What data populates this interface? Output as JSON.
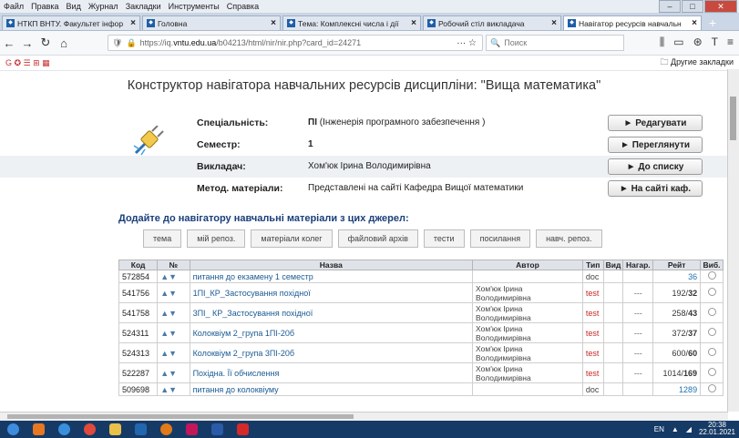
{
  "menu": [
    "Файл",
    "Правка",
    "Вид",
    "Журнал",
    "Закладки",
    "Инструменты",
    "Справка"
  ],
  "browser_tabs": [
    {
      "label": "НТКП ВНТУ. Факультет інфор",
      "active": false
    },
    {
      "label": "Головна",
      "active": false
    },
    {
      "label": "Тема: Комплексні числа і дії",
      "active": false
    },
    {
      "label": "Робочий стіл викладача",
      "active": false
    },
    {
      "label": "Навігатор ресурсів навчальн",
      "active": true
    }
  ],
  "url": {
    "prefix": "https://iq.",
    "domain": "vntu.edu.ua",
    "path": "/b04213/html/nir/nir.php?card_id=24271"
  },
  "search": {
    "placeholder": "Поиск"
  },
  "bookmarks": {
    "other": "Другие закладки"
  },
  "page": {
    "title": "Конструктор навігатора навчальних ресурсів дисципліни: \"Вища математика\"",
    "info": [
      {
        "label": "Спеціальність:",
        "value_bold": "ПІ",
        "value": " (Інженерія програмного забезпечення )"
      },
      {
        "label": "Семестр:",
        "value_bold": "1",
        "value": ""
      },
      {
        "label": "Викладач:",
        "value_bold": "",
        "value": "Хом'юк Ірина Володимирівна"
      },
      {
        "label": "Метод. матеріали:",
        "value_bold": "",
        "value": "Представлені на сайті Кафедра Вищої математики"
      }
    ],
    "buttons": [
      "► Редагувати",
      "► Переглянути",
      "► До списку",
      "► На сайті каф."
    ],
    "add_sources": "Додайте до навігатору навчальні матеріали з цих джерел:",
    "sources": [
      "тема",
      "мій репоз.",
      "матеріали колег",
      "файловий архів",
      "тести",
      "посилання",
      "навч. репоз."
    ]
  },
  "table": {
    "headers": [
      "Код",
      "№",
      "Назва",
      "Автор",
      "Тип",
      "Вид",
      "Нагар.",
      "Рейт",
      "Виб."
    ],
    "rows": [
      {
        "code": "572854",
        "arrows": "▲▼",
        "name": "питання до екзамену 1 семестр",
        "author": "",
        "type": "doc",
        "test": false,
        "award": "",
        "rating": "36",
        "rating_bold": "",
        "link": true
      },
      {
        "code": "541756",
        "arrows": "▲▼",
        "name": "1ПІ_КР_Застосування похідної",
        "author": "Хом'юк Ірина Володимирівна",
        "type": "test",
        "test": true,
        "award": "---",
        "rating": "192/",
        "rating_bold": "32",
        "link": false
      },
      {
        "code": "541758",
        "arrows": "▲▼",
        "name": "3ПІ_ КР_Застосування похідної",
        "author": "Хом'юк Ірина Володимирівна",
        "type": "test",
        "test": true,
        "award": "---",
        "rating": "258/",
        "rating_bold": "43",
        "link": false
      },
      {
        "code": "524311",
        "arrows": "▲▼",
        "name": "Колоквіум 2_група 1ПІ-20б",
        "author": "Хом'юк Ірина Володимирівна",
        "type": "test",
        "test": true,
        "award": "---",
        "rating": "372/",
        "rating_bold": "37",
        "link": false
      },
      {
        "code": "524313",
        "arrows": "▲▼",
        "name": "Колоквіум 2_група 3ПІ-20б",
        "author": "Хом'юк Ірина Володимирівна",
        "type": "test",
        "test": true,
        "award": "---",
        "rating": "600/",
        "rating_bold": "60",
        "link": false
      },
      {
        "code": "522287",
        "arrows": "▲▼",
        "name": "Похідна. Її обчислення",
        "author": "Хом'юк Ірина Володимирівна",
        "type": "test",
        "test": true,
        "award": "---",
        "rating": "1014/",
        "rating_bold": "169",
        "link": false
      },
      {
        "code": "509698",
        "arrows": "▲▼",
        "name": "питання до колоквіуму",
        "author": "",
        "type": "doc",
        "test": false,
        "award": "",
        "rating": "1289",
        "rating_bold": "",
        "link": true
      }
    ]
  },
  "tray": {
    "lang": "EN",
    "time": "20:38",
    "date": "22.01.2021"
  },
  "colors": {
    "taskbar": "#163a66",
    "link": "#1b5a93",
    "test": "#c82828",
    "heading": "#1a3f7a"
  }
}
